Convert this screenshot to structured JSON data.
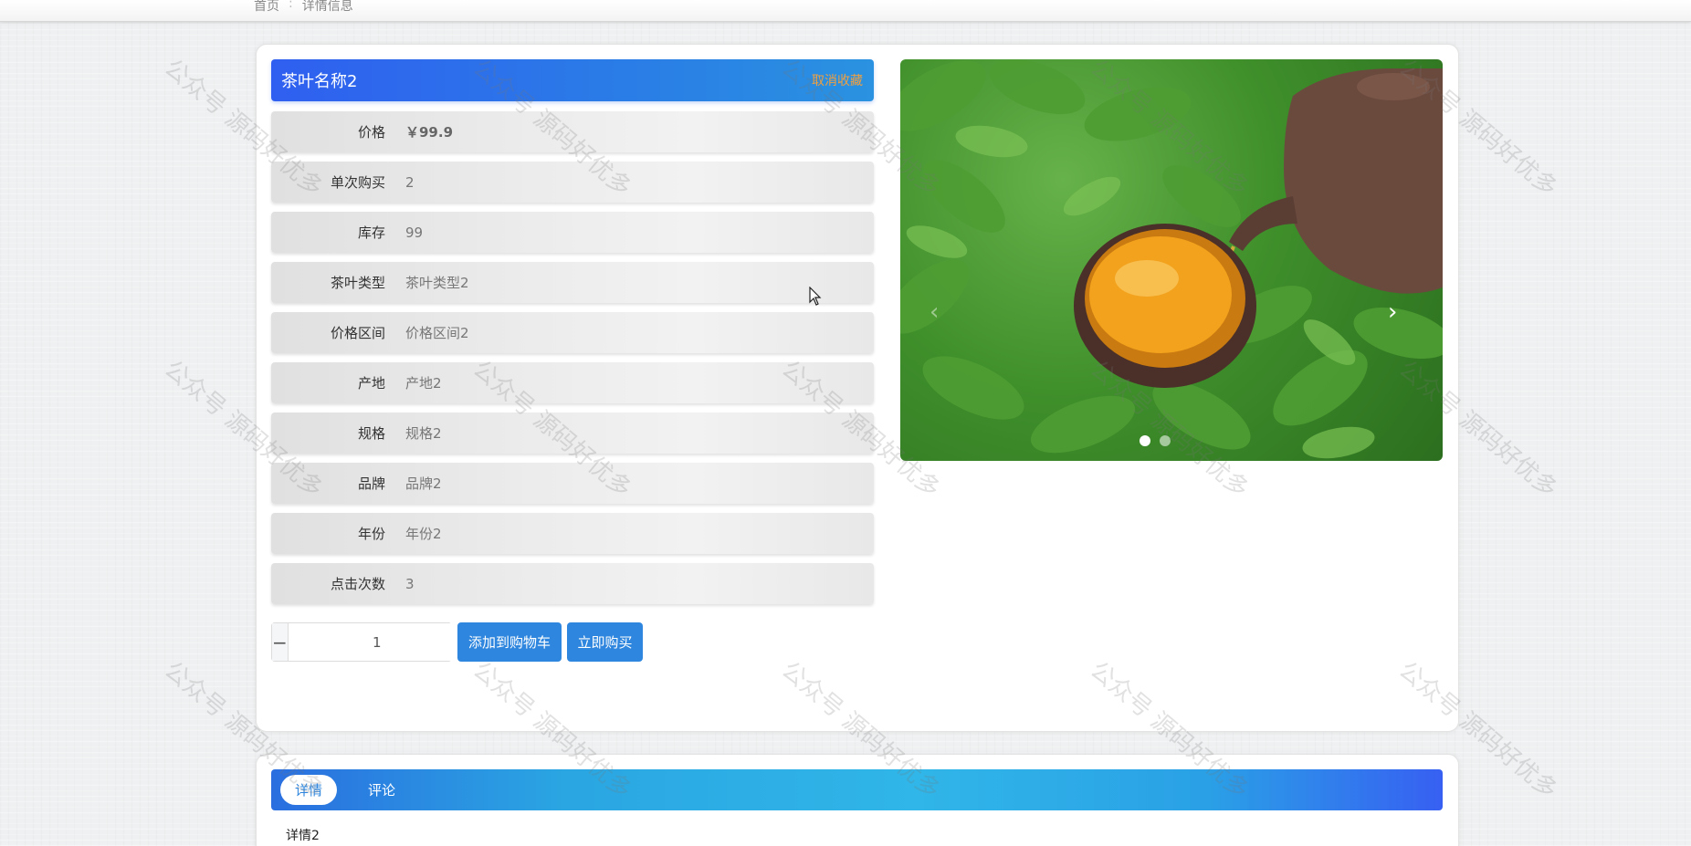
{
  "breadcrumb": {
    "home": "首页",
    "separator": ":",
    "current": "详情信息"
  },
  "product": {
    "name": "茶叶名称2",
    "favorite_label": "取消收藏"
  },
  "details": [
    {
      "label": "价格",
      "value": "￥99.9"
    },
    {
      "label": "单次购买",
      "value": "2"
    },
    {
      "label": "库存",
      "value": "99"
    },
    {
      "label": "茶叶类型",
      "value": "茶叶类型2"
    },
    {
      "label": "价格区间",
      "value": "价格区间2"
    },
    {
      "label": "产地",
      "value": "产地2"
    },
    {
      "label": "规格",
      "value": "规格2"
    },
    {
      "label": "品牌",
      "value": "品牌2"
    },
    {
      "label": "年份",
      "value": "年份2"
    },
    {
      "label": "点击次数",
      "value": "3"
    }
  ],
  "quantity": {
    "minus": "−",
    "value": "1",
    "plus": "+"
  },
  "actions": {
    "add_to_cart": "添加到购物车",
    "buy_now": "立即购买"
  },
  "carousel": {
    "prev": "‹",
    "next": "›",
    "slides": 2,
    "active_index": 0
  },
  "tabs": [
    {
      "label": "详情"
    },
    {
      "label": "评论"
    }
  ],
  "detail_content": "详情2",
  "watermark": "公众号 源码好优多",
  "colors": {
    "primary": "#2e86de",
    "favorite": "#f0a040",
    "title_gradient_start": "#2f5ff0"
  }
}
